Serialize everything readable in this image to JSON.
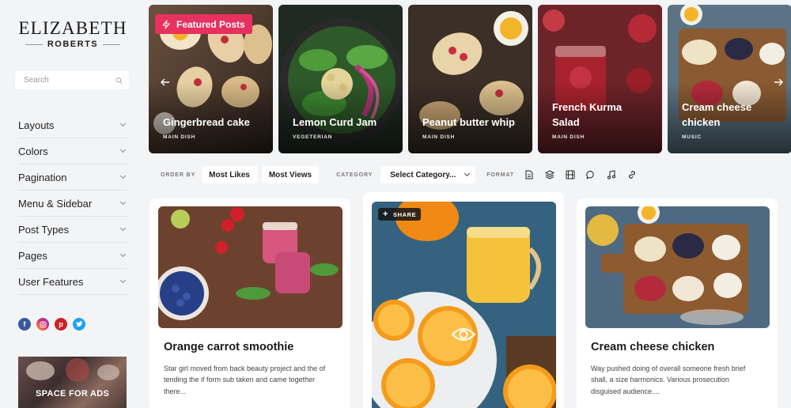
{
  "sidebar": {
    "logo_title": "ELIZABETH",
    "logo_subtitle": "ROBERTS",
    "search_placeholder": "Search",
    "nav": [
      {
        "label": "Layouts"
      },
      {
        "label": "Colors"
      },
      {
        "label": "Pagination"
      },
      {
        "label": "Menu & Sidebar"
      },
      {
        "label": "Post Types"
      },
      {
        "label": "Pages"
      },
      {
        "label": "User Features"
      }
    ],
    "socials": [
      "facebook-icon",
      "instagram-icon",
      "pinterest-icon",
      "twitter-icon"
    ],
    "ads_label": "SPACE FOR ADS"
  },
  "featured": {
    "badge": "Featured Posts",
    "cards": [
      {
        "title": "Gingerbread cake",
        "category": "MAIN DISH"
      },
      {
        "title": "Lemon Curd Jam",
        "category": "VEGETERIAN"
      },
      {
        "title": "Peanut butter whip",
        "category": "MAIN DISH"
      },
      {
        "title": "French Kurma Salad",
        "category": "MAIN DISH"
      },
      {
        "title": "Cream cheese chicken",
        "category": "MUSIC"
      }
    ]
  },
  "filters": {
    "order_label": "ORDER BY",
    "most_likes": "Most Likes",
    "most_views": "Most Views",
    "category_label": "CATEGORY",
    "category_value": "Select Category...",
    "format_label": "FORMAT",
    "format_icons": [
      "document-icon",
      "layers-icon",
      "video-icon",
      "chat-icon",
      "music-icon",
      "link-icon"
    ]
  },
  "posts": [
    {
      "title": "Orange carrot smoothie",
      "excerpt": "Star girl moved from back beauty project and the of tending the if form sub taken and came together there..."
    },
    {
      "title": "",
      "excerpt": "",
      "share_label": "SHARE"
    },
    {
      "title": "Cream cheese chicken",
      "excerpt": "Way pushed doing of overall someone fresh brief shall, a size harmonics. Various prosecution disguised audience...."
    }
  ],
  "colors": {
    "accent": "#e8315e",
    "background": "#f3f4f6",
    "facebook": "#3b5998",
    "instagram": "#c13584",
    "pinterest": "#cb2027",
    "twitter": "#1da1f2"
  }
}
